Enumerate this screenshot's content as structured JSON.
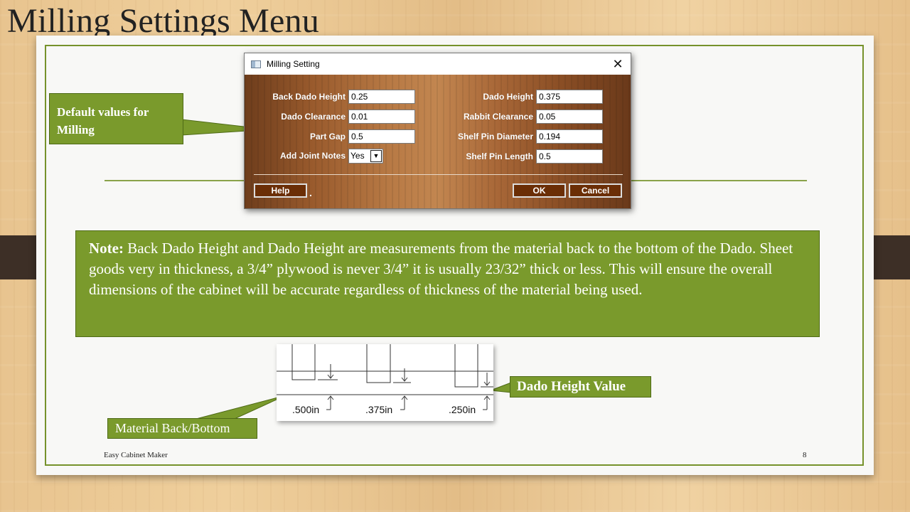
{
  "slide": {
    "title": "Milling Settings Menu",
    "footer_left": "Easy Cabinet Maker",
    "page_number": "8"
  },
  "dialog": {
    "title": "Milling Setting",
    "close_icon": "close-icon",
    "app_icon": "window-icon",
    "fields_left": [
      {
        "label": "Back Dado Height",
        "value": "0.25"
      },
      {
        "label": "Dado Clearance",
        "value": "0.01"
      },
      {
        "label": "Part Gap",
        "value": "0.5"
      }
    ],
    "add_joint_notes": {
      "label": "Add Joint Notes",
      "value": "Yes"
    },
    "fields_right": [
      {
        "label": "Dado Height",
        "value": "0.375"
      },
      {
        "label": "Rabbit Clearance",
        "value": "0.05"
      },
      {
        "label": "Shelf Pin Diameter",
        "value": "0.194"
      },
      {
        "label": "Shelf Pin Length",
        "value": "0.5"
      }
    ],
    "buttons": {
      "help": "Help",
      "dot": ".",
      "ok": "OK",
      "cancel": "Cancel"
    }
  },
  "callouts": {
    "default_values": "Default values for Milling",
    "note_label": "Note:",
    "note_text": " Back Dado Height and Dado Height are measurements from the material back to the bottom of  the Dado. Sheet goods very in thickness, a 3/4” plywood is never 3/4” it is usually 23/32” thick or less. This will ensure the overall dimensions of  the cabinet will be accurate regardless of  thickness of  the material being used.",
    "dado_height_value": "Dado Height Value",
    "material_back": "Material Back/Bottom"
  },
  "diagram": {
    "labels": [
      ".500in",
      ".375in",
      ".250in"
    ]
  },
  "colors": {
    "accent_green": "#7a9a2c",
    "button_brown": "#6b2e06"
  }
}
